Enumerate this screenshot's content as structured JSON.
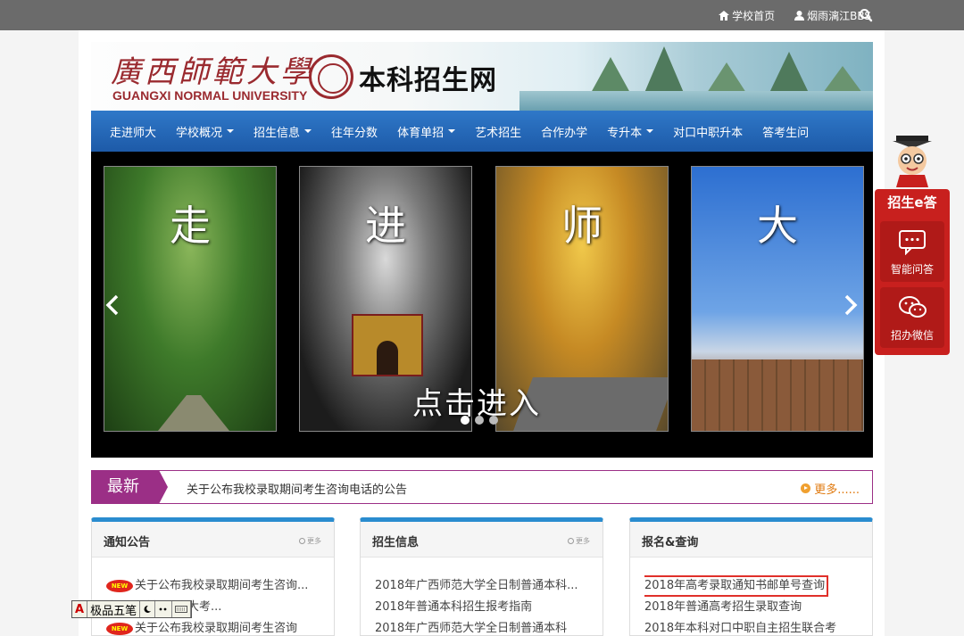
{
  "topbar": {
    "home_label": "学校首页",
    "bbs_label": "烟雨漓江BBS"
  },
  "banner": {
    "calligraphy": "廣西師範大學",
    "english_name": "GUANGXI NORMAL UNIVERSITY",
    "site_name": "本科招生网"
  },
  "nav": {
    "items": [
      {
        "label": "走进师大",
        "dropdown": false
      },
      {
        "label": "学校概况",
        "dropdown": true
      },
      {
        "label": "招生信息",
        "dropdown": true
      },
      {
        "label": "往年分数",
        "dropdown": false
      },
      {
        "label": "体育单招",
        "dropdown": true
      },
      {
        "label": "艺术招生",
        "dropdown": false
      },
      {
        "label": "合作办学",
        "dropdown": false
      },
      {
        "label": "专升本",
        "dropdown": true
      },
      {
        "label": "对口中职升本",
        "dropdown": false
      },
      {
        "label": "答考生问",
        "dropdown": false
      }
    ]
  },
  "slider": {
    "panels": [
      "走",
      "进",
      "师",
      "大"
    ],
    "overlay_text": "点击进入",
    "active_dot": 0,
    "dot_count": 3
  },
  "latest": {
    "tag": "最新",
    "headline": "关于公布我校录取期间考生咨询电话的公告",
    "more": "更多......"
  },
  "boxes": [
    {
      "title": "通知公告",
      "more": "更多",
      "items": [
        {
          "text": "关于公布我校录取期间考生咨询...",
          "new": true
        },
        {
          "text": "生考试院提醒广大考...",
          "new": false
        },
        {
          "text": "关于公布我校录取期间考生咨询",
          "new": true
        }
      ]
    },
    {
      "title": "招生信息",
      "more": "更多",
      "items": [
        {
          "text": "2018年广西师范大学全日制普通本科...",
          "new": false
        },
        {
          "text": "2018年普通本科招生报考指南",
          "new": false
        },
        {
          "text": "2018年广西师范大学全日制普通本科",
          "new": false
        }
      ]
    },
    {
      "title": "报名&查询",
      "more": "",
      "items": [
        {
          "text": "2018年高考录取通知书邮单号查询",
          "new": false,
          "highlight": true
        },
        {
          "text": "2018年普通高考招生录取查询",
          "new": false
        },
        {
          "text": "2018年本科对口中职自主招生联合考",
          "new": false
        }
      ]
    }
  ],
  "ime": {
    "mode": "A",
    "name": "极品五笔"
  },
  "float_widget": {
    "label": "招生e答",
    "buttons": [
      "智能问答",
      "招办微信"
    ]
  },
  "colors": {
    "nav_blue": "#1d5aa8",
    "latest_purple": "#9b2f86",
    "box_accent": "#2a8ccf",
    "float_red": "#c8201e"
  }
}
